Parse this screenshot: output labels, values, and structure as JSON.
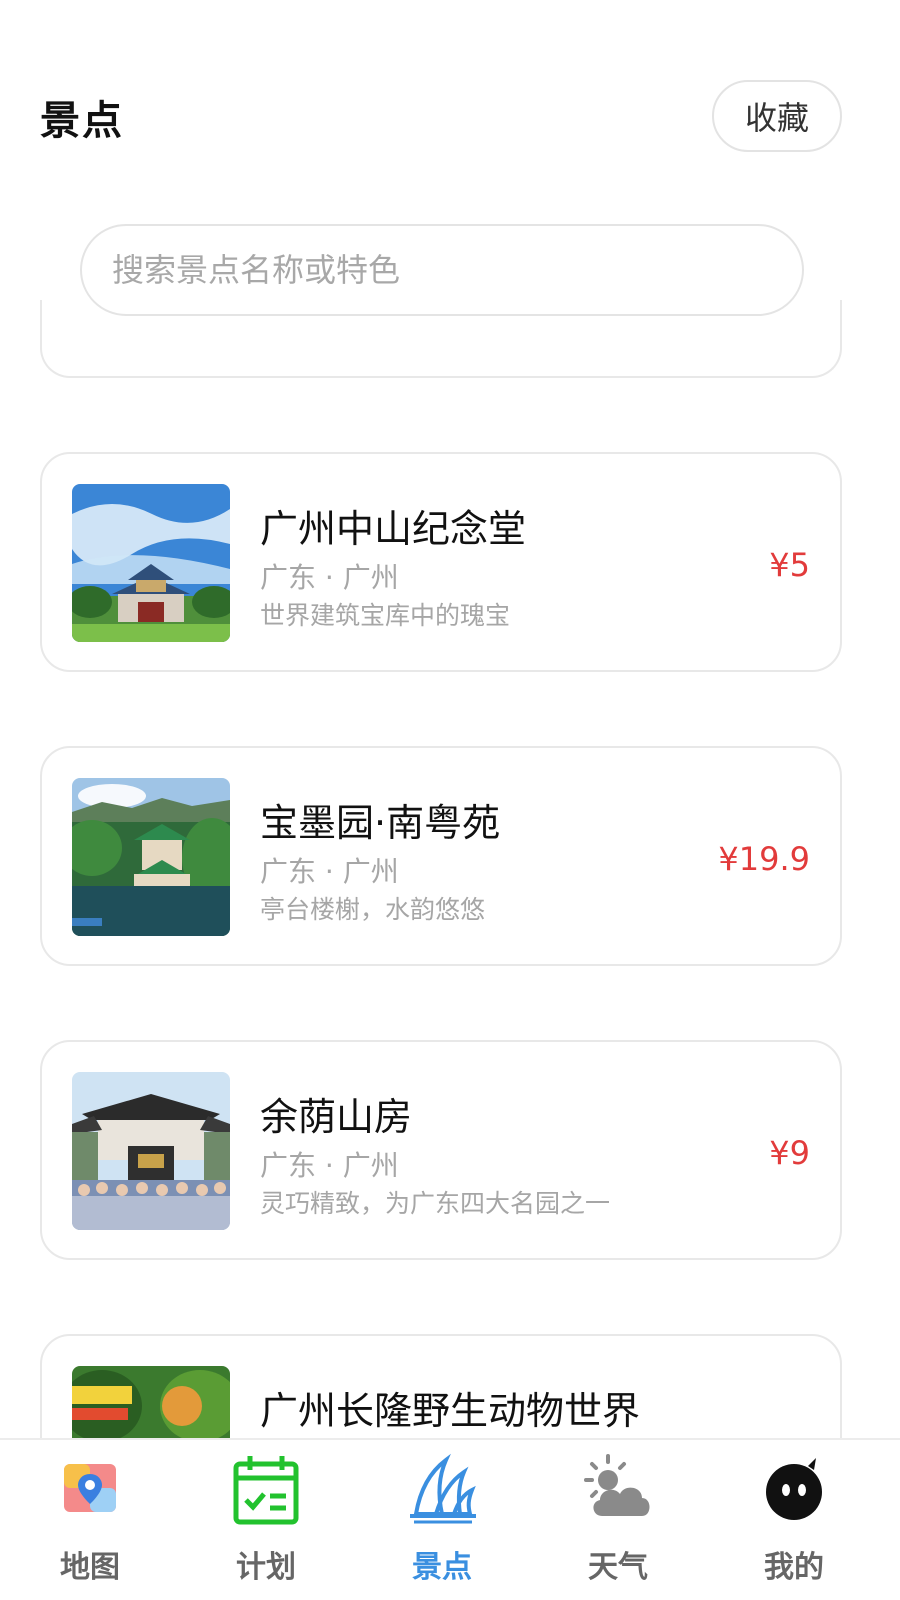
{
  "header": {
    "title": "景点",
    "favorites_label": "收藏"
  },
  "search": {
    "placeholder": "搜索景点名称或特色",
    "value": ""
  },
  "attractions": [
    {
      "name": "广州中山纪念堂",
      "region": "广东 · 广州",
      "desc": "世界建筑宝库中的瑰宝",
      "price": "¥5"
    },
    {
      "name": "宝墨园·南粤苑",
      "region": "广东 · 广州",
      "desc": "亭台楼榭，水韵悠悠",
      "price": "¥19.9"
    },
    {
      "name": "余荫山房",
      "region": "广东 · 广州",
      "desc": "灵巧精致，为广东四大名园之一",
      "price": "¥9"
    },
    {
      "name": "广州长隆野生动物世界",
      "region": "",
      "desc": "",
      "price": ""
    }
  ],
  "tabbar": {
    "items": [
      {
        "label": "地图",
        "icon": "map-icon"
      },
      {
        "label": "计划",
        "icon": "plan-calendar-icon"
      },
      {
        "label": "景点",
        "icon": "attraction-icon"
      },
      {
        "label": "天气",
        "icon": "weather-icon"
      },
      {
        "label": "我的",
        "icon": "profile-icon"
      }
    ],
    "active": "景点"
  },
  "colors": {
    "price": "#e23b3b",
    "tab_active": "#3a8fe0",
    "tab_inactive": "#666666",
    "plan_icon": "#22c22e"
  }
}
